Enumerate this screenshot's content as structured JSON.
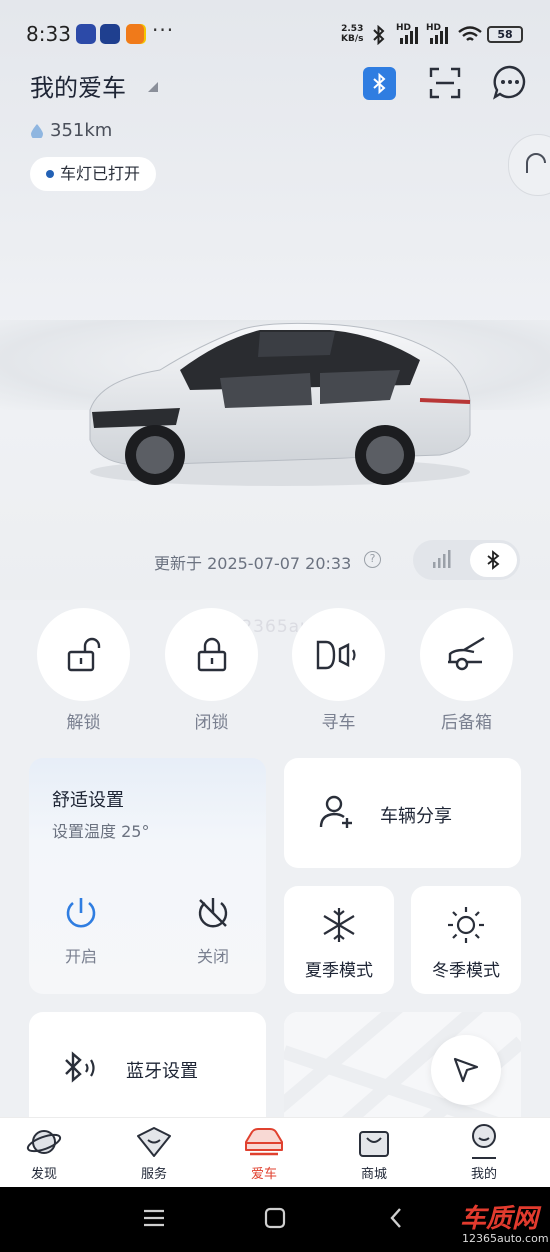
{
  "status_bar": {
    "time": "8:33",
    "dots": "···",
    "net_speed_value": "2.53",
    "net_speed_unit": "KB/s",
    "hd1": "HD",
    "hd2": "HD",
    "battery": "58"
  },
  "header": {
    "title": "我的爱车",
    "range": "351km",
    "status_chip": "车灯已打开"
  },
  "vehicle": {
    "updated": "更新于 2025-07-07 20:33"
  },
  "quick_actions": [
    {
      "label": "解锁"
    },
    {
      "label": "闭锁"
    },
    {
      "label": "寻车"
    },
    {
      "label": "后备箱"
    }
  ],
  "comfort": {
    "title": "舒适设置",
    "subtitle": "设置温度 25°",
    "on_label": "开启",
    "off_label": "关闭"
  },
  "share": {
    "label": "车辆分享"
  },
  "modes": {
    "summer": "夏季模式",
    "winter": "冬季模式"
  },
  "bluetooth_settings": {
    "label": "蓝牙设置"
  },
  "tabs": [
    {
      "label": "发现"
    },
    {
      "label": "服务"
    },
    {
      "label": "爱车"
    },
    {
      "label": "商城"
    },
    {
      "label": "我的"
    }
  ],
  "active_tab_color": "#e0412f",
  "accent_color": "#2f7de1",
  "watermark": "www.12365auto.com",
  "logo": {
    "title": "车质网",
    "site": "12365auto.com"
  }
}
